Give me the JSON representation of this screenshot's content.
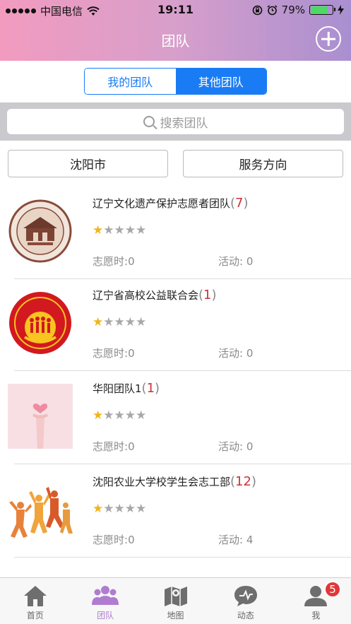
{
  "status_bar": {
    "carrier": "中国电信",
    "time": "19:11",
    "battery": "79%",
    "battery_level": 0.79
  },
  "nav": {
    "title": "团队"
  },
  "segment": {
    "mine": "我的团队",
    "other": "其他团队",
    "selected": "其他团队"
  },
  "search": {
    "placeholder": "搜索团队"
  },
  "filters": {
    "city": "沈阳市",
    "direction": "服务方向"
  },
  "teams": [
    {
      "name": "辽宁文化遗产保护志愿者团队",
      "count": "7",
      "rating": 1,
      "hours_label": "志愿时:",
      "hours": "0",
      "acts_label": "活动: ",
      "acts": "0",
      "logo": "heritage-seal-logo"
    },
    {
      "name": "辽宁省高校公益联合会",
      "count": "1",
      "rating": 1,
      "hours_label": "志愿时:",
      "hours": "0",
      "acts_label": "活动: ",
      "acts": "0",
      "logo": "red-union-logo"
    },
    {
      "name": "华阳团队1",
      "count": "1",
      "rating": 1,
      "hours_label": "志愿时:",
      "hours": "0",
      "acts_label": "活动: ",
      "acts": "0",
      "logo": "heart-hand-photo"
    },
    {
      "name": "沈阳农业大学校学生会志工部",
      "count": "12",
      "rating": 1,
      "hours_label": "志愿时:",
      "hours": "0",
      "acts_label": "活动: ",
      "acts": "4",
      "logo": "jumping-people-photo"
    }
  ],
  "tabs": [
    {
      "label": "首页",
      "icon": "home-icon"
    },
    {
      "label": "团队",
      "icon": "team-icon",
      "active": true
    },
    {
      "label": "地图",
      "icon": "map-icon"
    },
    {
      "label": "动态",
      "icon": "activity-icon"
    },
    {
      "label": "我",
      "icon": "profile-icon",
      "badge": "5"
    }
  ],
  "colors": {
    "accent": "#1a7cf5",
    "active_tab": "#b07ccf",
    "count": "#c8323a",
    "star_on": "#f2b418",
    "badge": "#e0373a"
  }
}
